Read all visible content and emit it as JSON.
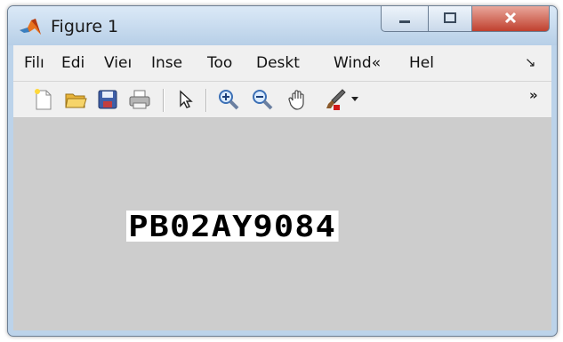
{
  "window": {
    "title": "Figure 1"
  },
  "menubar": {
    "items": [
      "Filı",
      "Edi",
      "Vieı",
      "Inse",
      "Too",
      "Deskt",
      "Wind«",
      "Hel"
    ],
    "overflow_glyph": "↘"
  },
  "toolbar": {
    "buttons": [
      {
        "name": "new-figure",
        "icon": "new-file-icon"
      },
      {
        "name": "open-file",
        "icon": "folder-open-icon"
      },
      {
        "name": "save-figure",
        "icon": "save-icon"
      },
      {
        "name": "print-figure",
        "icon": "printer-icon"
      },
      {
        "name": "edit-plot",
        "icon": "arrow-pointer-icon"
      },
      {
        "name": "zoom-in",
        "icon": "zoom-in-icon"
      },
      {
        "name": "zoom-out",
        "icon": "zoom-out-icon"
      },
      {
        "name": "pan",
        "icon": "hand-icon"
      },
      {
        "name": "brush",
        "icon": "brush-icon"
      }
    ],
    "overflow_glyph": "»"
  },
  "figure": {
    "text": "PB02AY9084"
  }
}
